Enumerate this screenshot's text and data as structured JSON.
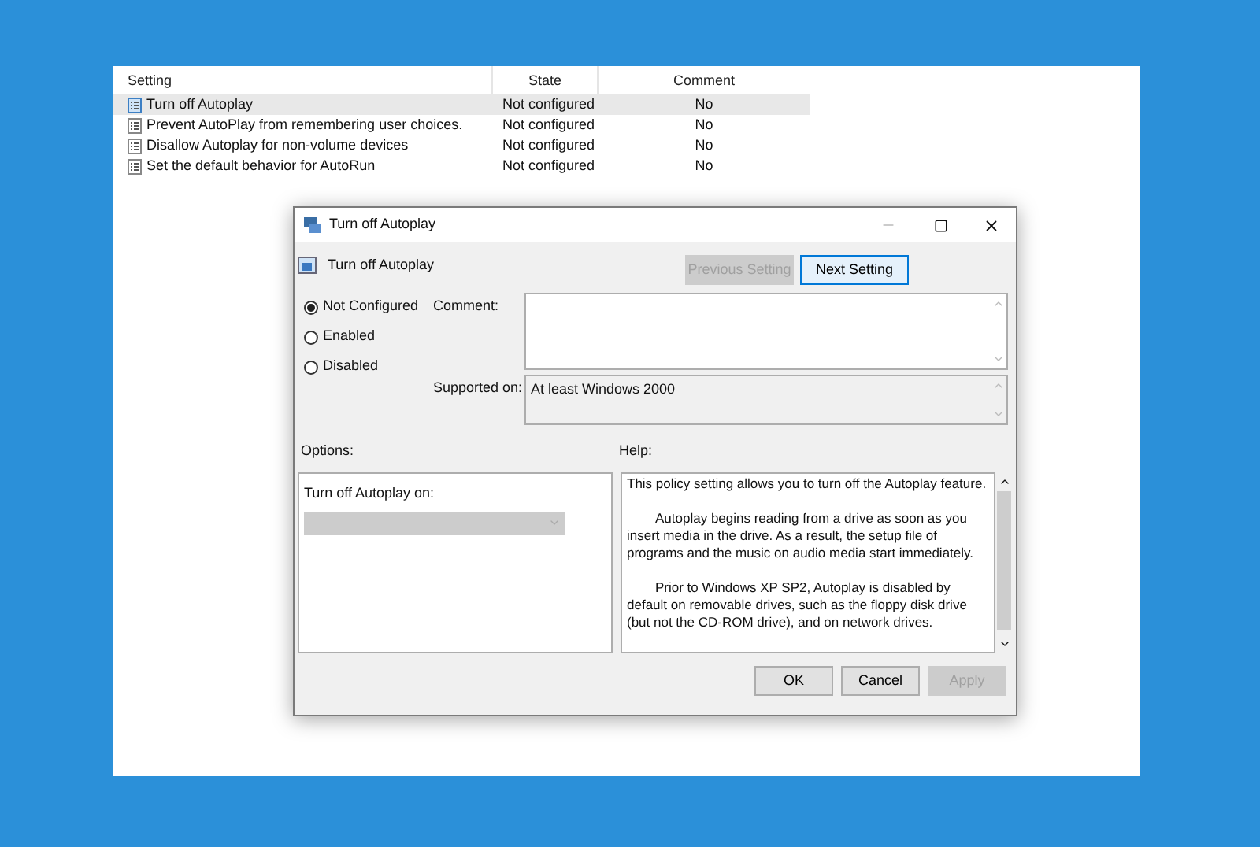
{
  "table": {
    "columns": [
      "Setting",
      "State",
      "Comment"
    ],
    "rows": [
      {
        "setting": "Turn off Autoplay",
        "state": "Not configured",
        "comment": "No",
        "selected": true
      },
      {
        "setting": "Prevent AutoPlay from remembering user choices.",
        "state": "Not configured",
        "comment": "No",
        "selected": false
      },
      {
        "setting": "Disallow Autoplay for non-volume devices",
        "state": "Not configured",
        "comment": "No",
        "selected": false
      },
      {
        "setting": "Set the default behavior for AutoRun",
        "state": "Not configured",
        "comment": "No",
        "selected": false
      }
    ]
  },
  "dialog": {
    "title": "Turn off Autoplay",
    "heading": "Turn off Autoplay",
    "nav_buttons": [
      {
        "label": "Previous Setting",
        "disabled": true
      },
      {
        "label": "Next Setting",
        "disabled": false
      }
    ],
    "radios": [
      {
        "label": "Not Configured",
        "selected": true
      },
      {
        "label": "Enabled",
        "selected": false
      },
      {
        "label": "Disabled",
        "selected": false
      }
    ],
    "comment_label": "Comment:",
    "supported_label": "Supported on:",
    "supported_value": "At least Windows 2000",
    "options_label": "Options:",
    "help_label": "Help:",
    "option_field_label": "Turn off Autoplay on:",
    "help_paragraphs": [
      "This policy setting allows you to turn off the Autoplay feature.",
      "Autoplay begins reading from a drive as soon as you insert media in the drive. As a result, the setup file of programs and the music on audio media start immediately.",
      "Prior to Windows XP SP2, Autoplay is disabled by default on removable drives, such as the floppy disk drive (but not the CD-ROM drive), and on network drives."
    ],
    "buttons": [
      {
        "label": "OK",
        "disabled": false
      },
      {
        "label": "Cancel",
        "disabled": false
      },
      {
        "label": "Apply",
        "disabled": true
      }
    ]
  }
}
